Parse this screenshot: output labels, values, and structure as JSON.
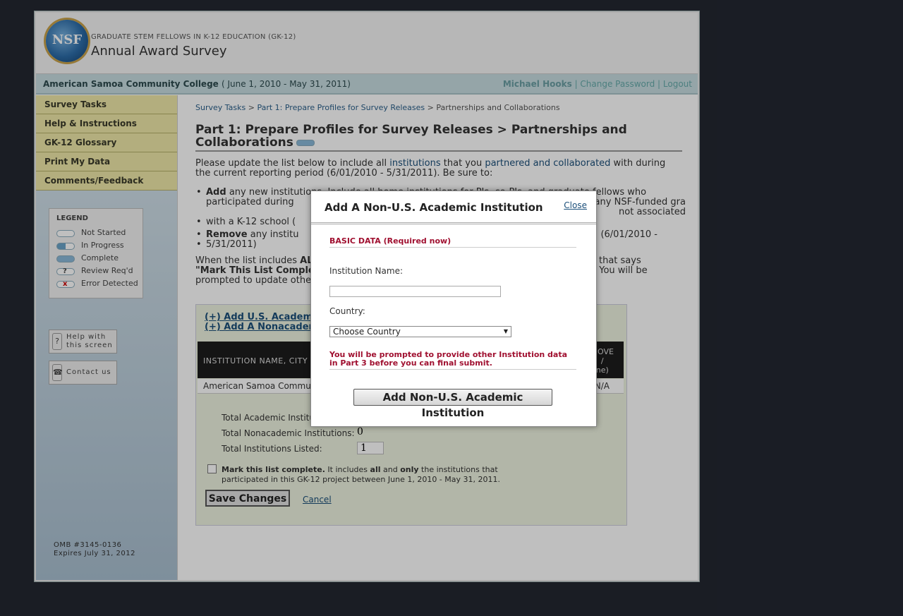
{
  "header": {
    "logo_text": "NSF",
    "program": "GRADUATE STEM FELLOWS IN K-12 EDUCATION (GK-12)",
    "title": "Annual Award Survey"
  },
  "infobar": {
    "institution": "American Samoa Community College",
    "period": "( June 1, 2010 - May 31, 2011)",
    "user": "Michael Hooks",
    "sep1": " | ",
    "change_password": "Change Password",
    "sep2": " | ",
    "logout": "Logout"
  },
  "sidebar": {
    "items": [
      {
        "label": "Survey Tasks"
      },
      {
        "label": "Help & Instructions"
      },
      {
        "label": "GK-12 Glossary"
      },
      {
        "label": "Print My Data"
      },
      {
        "label": "Comments/Feedback"
      }
    ],
    "legend": {
      "title": "LEGEND",
      "rows": [
        {
          "label": "Not Started"
        },
        {
          "label": "In Progress"
        },
        {
          "label": "Complete"
        },
        {
          "label": "Review Req'd",
          "mark": "?"
        },
        {
          "label": "Error Detected",
          "mark": "x"
        }
      ]
    },
    "help_button": "Help with this screen",
    "contact_button": "Contact us",
    "omb_line1": "OMB #3145-0136",
    "omb_line2": "Expires July 31, 2012"
  },
  "main": {
    "breadcrumb": {
      "link1": "Survey Tasks",
      "sep": " > ",
      "link2": "Part 1: Prepare Profiles for Survey Releases",
      "current": "Partnerships and Collaborations"
    },
    "title": "Part 1: Prepare Profiles for Survey Releases > Partnerships and Collaborations",
    "intro_pre": "Please update the list below to include all ",
    "intro_link1": "institutions",
    "intro_mid": " that you ",
    "intro_link2": "partnered and collaborated",
    "intro_post": " with during the current reporting period (6/01/2010 - 5/31/2011). Be sure to:",
    "bullet1_bold": "Add",
    "bullet1_text": " any new institutions. Include all home institutions for PIs, co-PIs, and graduate fellows who participated during",
    "bullet1_tail": "e worksites for any NSF-funded gra",
    "bullet1_tail2": "not associated",
    "bullet1_tail3": "with a K-12 school (",
    "bullet2_bold": "Remove",
    "bullet2_text": " any institu",
    "bullet2_tail": "(6/01/2010 -",
    "bullet2_tail2": "5/31/2011)",
    "para2_a": "When the list includes ",
    "para2_a_bold": "ALL",
    "para2_a_tail": "that says",
    "para2_b_bold": "\"Mark This List Complete",
    "para2_b_tail": ". You will be",
    "para2_c": "prompted to update other",
    "add_us_link": "(+) Add U.S. Academic",
    "add_nonacad_link": "(+) Add A Nonacademi",
    "table": {
      "col1": "INSTITUTION NAME, CITY A",
      "col2_line1": "MOVE",
      "col2_line2": "/",
      "col2_line3": "ne)",
      "row1_name": "American Samoa Commun",
      "row1_action": "N/A"
    },
    "totals": {
      "academic_label": "Total Academic Institu",
      "nonacademic_label": "Total Nonacademic Institutions:",
      "nonacademic_value": "0",
      "listed_label": "Total Institutions Listed:",
      "listed_value": "1"
    },
    "complete_bold": "Mark this list complete.",
    "complete_text1": " It includes ",
    "complete_all": "all",
    "complete_and": " and ",
    "complete_only": "only",
    "complete_text2": " the institutions that participated in this GK-12 project between June 1, 2010 - May 31, 2011.",
    "save_label": "Save Changes",
    "cancel_label": "Cancel"
  },
  "modal": {
    "title": "Add A Non-U.S. Academic Institution",
    "close": "Close",
    "section": "BASIC DATA (Required now)",
    "name_label": "Institution Name:",
    "name_value": "",
    "country_label": "Country:",
    "country_value": "Choose Country",
    "note": "You will be prompted to provide other Institution data in Part 3 before you can final submit.",
    "submit": "Add Non-U.S. Academic Institution"
  }
}
